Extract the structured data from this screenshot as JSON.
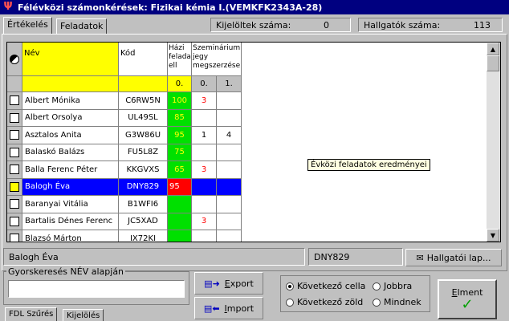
{
  "window": {
    "title": "Félévközi számonkérések: Fizikai kémia I.(VEMKFK2343A-28)"
  },
  "tabs": [
    {
      "label": "Értékelés"
    },
    {
      "label": "Feladatok"
    }
  ],
  "info": {
    "selected_label": "Kijelöltek száma:",
    "selected_value": "0",
    "students_label": "Hallgatók száma:",
    "students_value": "113"
  },
  "grid": {
    "headers": {
      "name": "Név",
      "code": "Kód",
      "hazi": "Házi feladatok ell",
      "szem": "Szemináriumi jegy megszerzése",
      "sub0": "0.",
      "sub0b": "0.",
      "sub1": "1."
    },
    "rows": [
      {
        "name": "Albert Mónika",
        "code": "C6RW5N",
        "hazi": "100",
        "s0": "3",
        "s1": "",
        "hazi_color": "green",
        "s0_color": "red"
      },
      {
        "name": "Albert Orsolya",
        "code": "UL49SL",
        "hazi": "85",
        "s0": "",
        "s1": "",
        "hazi_color": "green",
        "s0_color": ""
      },
      {
        "name": "Asztalos Anita",
        "code": "G3W86U",
        "hazi": "95",
        "s0": "1",
        "s1": "4",
        "hazi_color": "green",
        "s0_color": "black"
      },
      {
        "name": "Balaskó Balázs",
        "code": "FU5L8Z",
        "hazi": "75",
        "s0": "",
        "s1": "",
        "hazi_color": "green",
        "s0_color": ""
      },
      {
        "name": "Balla Ferenc Péter",
        "code": "KKGVXS",
        "hazi": "65",
        "s0": "3",
        "s1": "",
        "hazi_color": "green",
        "s0_color": "red"
      },
      {
        "name": "Balogh Éva",
        "code": "DNY829",
        "hazi": "95",
        "s0": "",
        "s1": "",
        "hazi_color": "red",
        "s0_color": ""
      },
      {
        "name": "Baranyai Vitália",
        "code": "B1WFI6",
        "hazi": "",
        "s0": "",
        "s1": "",
        "hazi_color": "green",
        "s0_color": ""
      },
      {
        "name": "Bartalis Dénes Ferenc",
        "code": "JC5XAD",
        "hazi": "",
        "s0": "3",
        "s1": "",
        "hazi_color": "green",
        "s0_color": "red"
      },
      {
        "name": "Blazsó Márton",
        "code": "IX72KI",
        "hazi": "",
        "s0": "",
        "s1": "",
        "hazi_color": "green",
        "s0_color": ""
      }
    ],
    "selected_row": 5,
    "tooltip": "Évközi feladatok eredményei"
  },
  "status": {
    "name": "Balogh Éva",
    "code": "DNY829",
    "student_sheet_button": "Hallgatói lap..."
  },
  "search": {
    "label": "Gyorskeresés NÉV alapján",
    "value": ""
  },
  "buttons": {
    "export": "Export",
    "import": "Import",
    "save": "Elment"
  },
  "options": {
    "next_cell": "Következő cella",
    "next_green": "Következő zöld",
    "right": "Jobbra",
    "down": "Mindnek",
    "selected": "next_cell"
  },
  "bottom_tabs": [
    {
      "label": "FDL Szűrés"
    },
    {
      "label": "Kijelölés"
    }
  ],
  "colors": {
    "title_bar": "#000080",
    "header_yellow": "#ffff00",
    "good": "#00e000",
    "bad": "#ff0000",
    "selection": "#0000ff"
  }
}
